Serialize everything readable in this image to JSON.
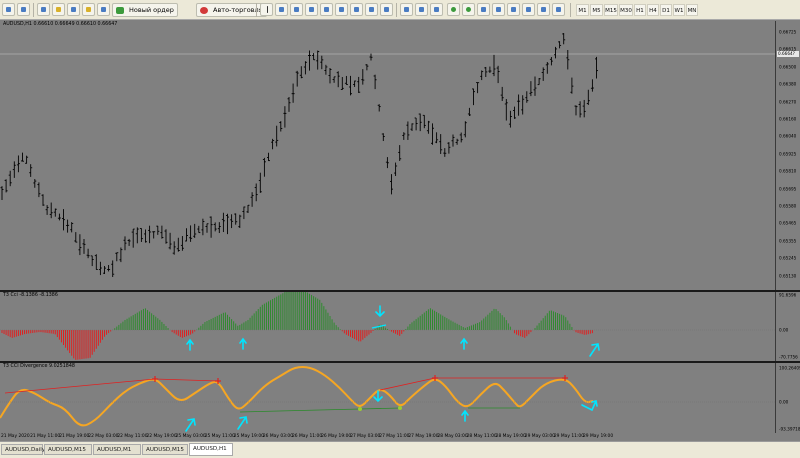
{
  "toolbar": {
    "new_order_label": "Новый ордер",
    "auto_trading_label": "Авто-торговля",
    "timeframes": [
      "M1",
      "M5",
      "M15",
      "M30",
      "H1",
      "H4",
      "D1",
      "W1",
      "MN"
    ]
  },
  "main_chart": {
    "header": "AUDUSD,H1  0.66610 0.66649 0.66610 0.66647",
    "current_price": "0.6664?",
    "ticks": [
      "0.66725",
      "0.66615",
      "0.66500",
      "0.66380",
      "0.66270",
      "0.66160",
      "0.66040",
      "0.65925",
      "0.65810",
      "0.65695",
      "0.65580",
      "0.65465",
      "0.65355",
      "0.65245",
      "0.65130"
    ]
  },
  "cci_pane": {
    "header": "T3 Cci -8.1386 -8.1386",
    "ticks": [
      "91.6596",
      "0.00",
      "-70.7756"
    ]
  },
  "div_pane": {
    "header": "T3 CCI Divergence 9.0251848",
    "ticks": [
      "100.26409",
      "0.00",
      "-93.39718"
    ]
  },
  "time_axis": {
    "labels": [
      "21 May 2020",
      "21 May 11:00",
      "21 May 19:00",
      "22 May 03:00",
      "22 May 11:00",
      "22 May 19:00",
      "25 May 03:00",
      "25 May 11:00",
      "25 May 19:00",
      "26 May 03:00",
      "26 May 11:00",
      "26 May 19:00",
      "27 May 03:00",
      "27 May 11:00",
      "27 May 19:00",
      "28 May 03:00",
      "28 May 11:00",
      "28 May 19:00",
      "29 May 03:00",
      "29 May 11:00",
      "29 May 19:00"
    ]
  },
  "tabs": [
    "AUDUSD,Daily",
    "AUDUSD,M15",
    "AUDUSD,M1",
    "AUDUSD,M15",
    "AUDUSD,H1"
  ],
  "active_tab": 4,
  "colors": {
    "background": "#808080",
    "bars": "#000000",
    "cci_positive": "#2e8b2e",
    "cci_negative": "#e02020",
    "divergence_line": "#f5a623",
    "bearish_divergence": "#e02020",
    "bullish_divergence": "#2a8a2a",
    "arrows": "#00e5ff"
  },
  "icons": {
    "chart_icon": "chart-icon",
    "new_order_icon": "new-order-icon",
    "auto_trading_icon": "auto-trading-icon",
    "cursor_icon": "cursor-icon",
    "crosshair_icon": "crosshair-icon",
    "zoom_in_icon": "zoom-in-icon",
    "zoom_out_icon": "zoom-out-icon",
    "arrow_icon": "arrow-up-icon"
  }
}
